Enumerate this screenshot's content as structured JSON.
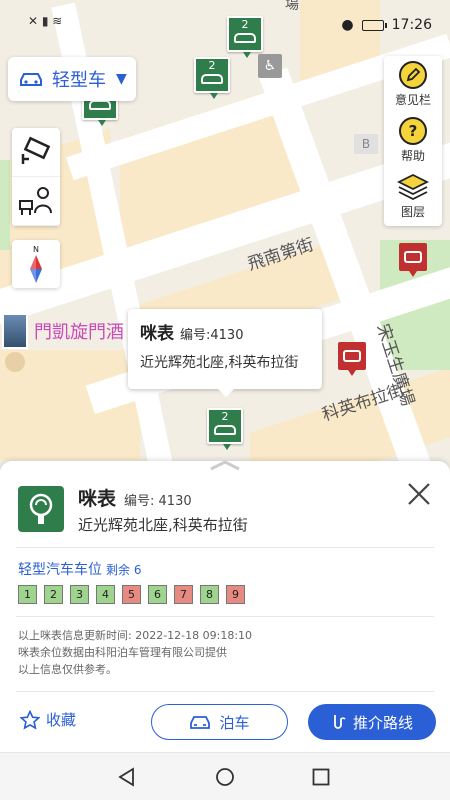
{
  "status_bar": {
    "left_icons": "✕ ▮ ≋",
    "time": "17:26"
  },
  "vehicle_selector": {
    "label": "轻型车",
    "caret": "▼"
  },
  "right_tools": [
    {
      "label": "意见栏",
      "icon": "pencil-icon"
    },
    {
      "label": "帮助",
      "icon": "help-icon",
      "glyph": "?"
    },
    {
      "label": "图层",
      "icon": "layers-icon"
    }
  ],
  "map": {
    "streets": [
      "飛南第街",
      "科英布拉街",
      "宋玉生廣場"
    ],
    "hotel": "門凱旋門酒",
    "b_marker": "B",
    "partial_top": "場",
    "parking_markers": [
      "2",
      "2",
      "2"
    ],
    "disabled_symbol": "♿",
    "compass_n": "N"
  },
  "callout": {
    "title": "咪表",
    "code": "编号:4130",
    "address": "近光辉苑北座,科英布拉街"
  },
  "sheet": {
    "title": "咪表",
    "code": "编号: 4130",
    "address": "近光辉苑北座,科英布拉街",
    "slot_title": "轻型汽车车位",
    "remaining": "剩余 6",
    "slots": [
      {
        "n": "1",
        "status": "free"
      },
      {
        "n": "2",
        "status": "free"
      },
      {
        "n": "3",
        "status": "free"
      },
      {
        "n": "4",
        "status": "free"
      },
      {
        "n": "5",
        "status": "occupied"
      },
      {
        "n": "6",
        "status": "free"
      },
      {
        "n": "7",
        "status": "occupied"
      },
      {
        "n": "8",
        "status": "free"
      },
      {
        "n": "9",
        "status": "occupied"
      }
    ],
    "info_lines": [
      "以上咪表信息更新时间:  2022-12-18 09:18:10",
      "咪表余位数据由科阳泊车管理有限公司提供",
      "以上信息仅供参考。"
    ],
    "favorite_label": "收藏",
    "park_label": "泊车",
    "route_label": "推介路线"
  },
  "colors": {
    "accent": "#2b5fd6",
    "parking_green": "#2e7d4a",
    "slot_free": "#9fd48f",
    "slot_occupied": "#e68a82",
    "bus_red": "#c03030"
  }
}
